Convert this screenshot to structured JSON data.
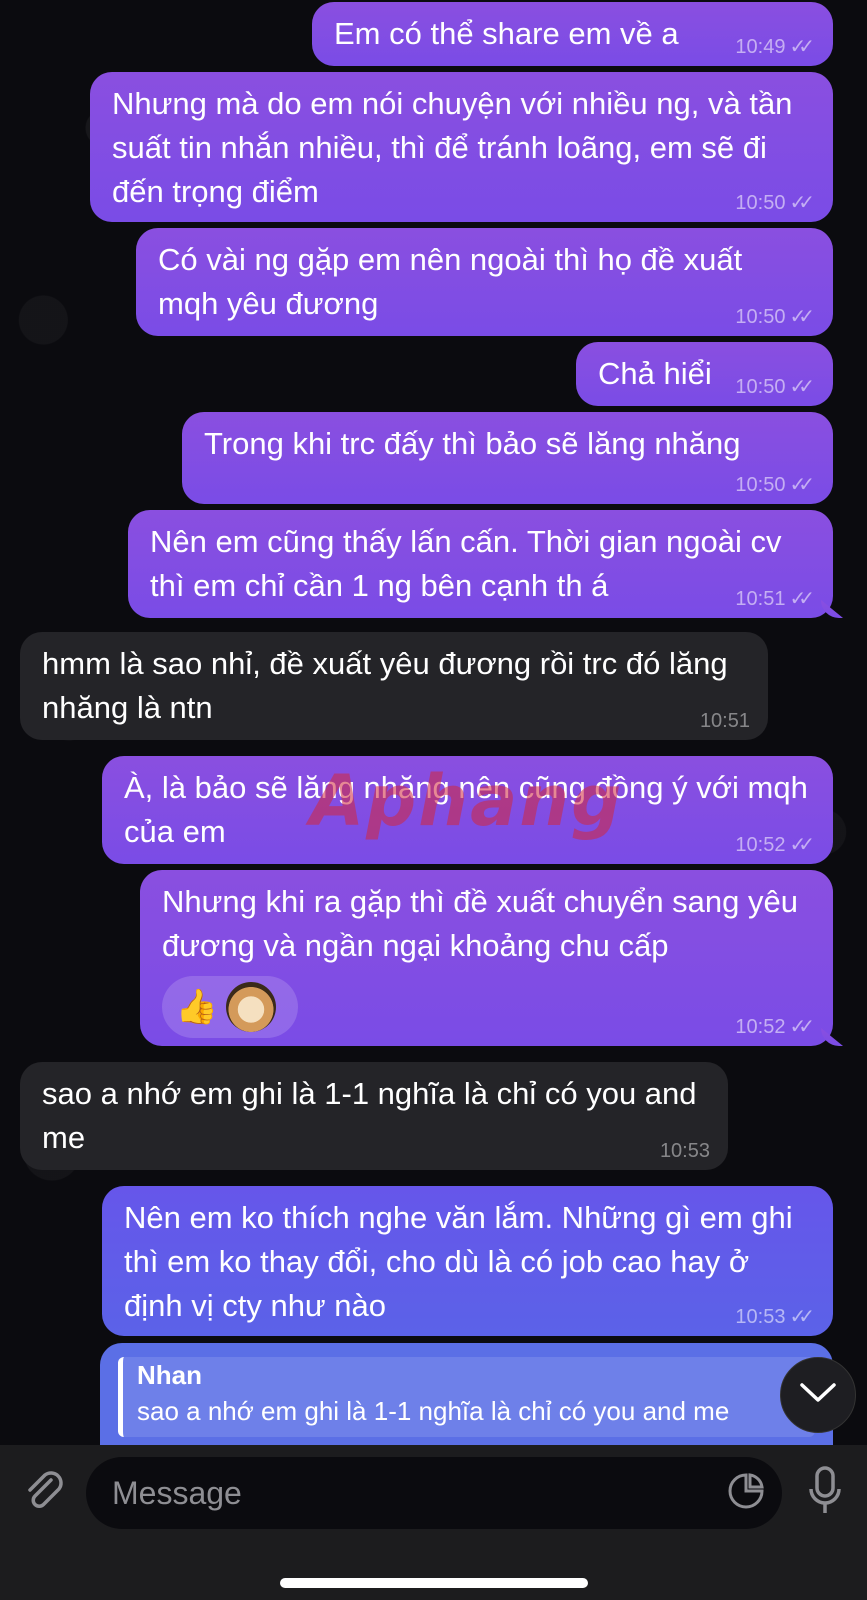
{
  "messages": [
    {
      "text": "Em có thể share em về a",
      "time": "10:49",
      "ticks": "✓✓"
    },
    {
      "text": "Nhưng mà do em nói chuyện với nhiều ng, và tần suất tin nhắn nhiều, thì để tránh loãng, em sẽ đi đến trọng điểm",
      "time": "10:50",
      "ticks": "✓✓"
    },
    {
      "text": "Có vài ng gặp em nên ngoài thì họ đề xuất mqh yêu đương",
      "time": "10:50",
      "ticks": "✓✓"
    },
    {
      "text": "Chả hiểi",
      "time": "10:50",
      "ticks": "✓✓"
    },
    {
      "text": "Trong khi trc đấy thì bảo sẽ lăng nhăng",
      "time": "10:50",
      "ticks": "✓✓"
    },
    {
      "text": "Nên em cũng thấy lấn cấn. Thời gian ngoài cv thì em chỉ cần 1 ng bên cạnh th á",
      "time": "10:51",
      "ticks": "✓✓"
    },
    {
      "text": "hmm là sao nhỉ, đề xuất yêu đương rồi trc đó lăng nhăng là ntn",
      "time": "10:51"
    },
    {
      "text": "À, là bảo sẽ lăng nhăng nên cũng đồng ý với mqh của em",
      "time": "10:52",
      "ticks": "✓✓"
    },
    {
      "text": "Nhưng khi ra gặp thì đề xuất chuyển sang yêu đương và ngần ngại khoảng chu cấp",
      "time": "10:52",
      "ticks": "✓✓",
      "reactions": [
        "thumbs-up",
        "avatar"
      ]
    },
    {
      "text": "sao a nhớ em ghi là 1-1 nghĩa là chỉ có you and me",
      "time": "10:53"
    },
    {
      "text": "Nên em ko thích nghe văn lắm. Những gì em ghi thì em ko thay đổi, cho dù là có job cao hay ở định vị cty như nào",
      "time": "10:53",
      "ticks": "✓✓"
    }
  ],
  "reply": {
    "name": "Nhan",
    "text": "sao a nhớ em ghi là 1-1 nghĩa là chỉ có you and me"
  },
  "watermark": "Aphang",
  "composer": {
    "placeholder": "Message"
  },
  "colors": {
    "outgoing": "#8a4fe0",
    "incoming": "#242428",
    "reply": "#5b6fe6"
  }
}
